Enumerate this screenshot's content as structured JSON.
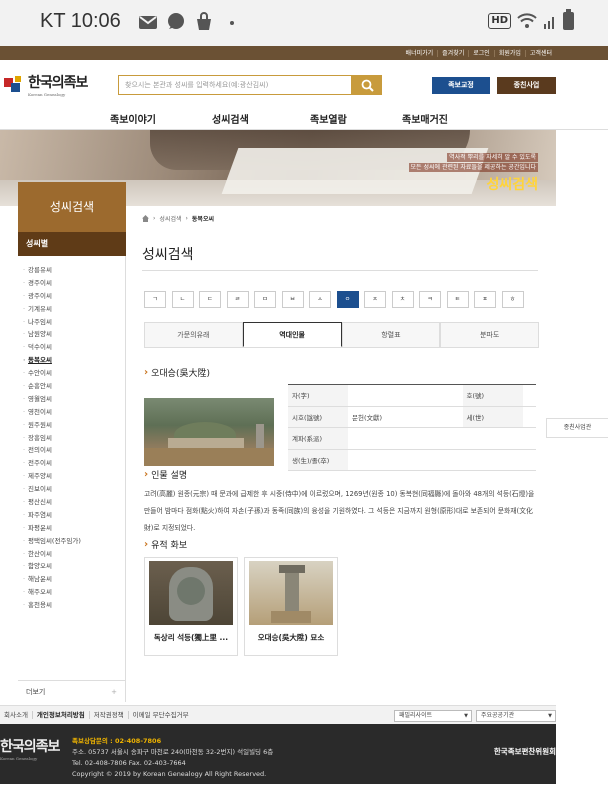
{
  "status_bar": {
    "carrier_time": "KT 10:06",
    "hd": "HD"
  },
  "util_links": [
    "배너미가기",
    "즐겨찾기",
    "로그인",
    "회원가입",
    "고객센터"
  ],
  "logo": {
    "title": "한국의족보",
    "subtitle": "Korean Genealogy"
  },
  "search": {
    "placeholder": "찾으시는 본관과 성씨를 입력하세요(예:광산김씨)"
  },
  "header_buttons": {
    "primary": "족보교정",
    "secondary": "종친사업"
  },
  "gnb": [
    "족보이야기",
    "성씨검색",
    "족보열람",
    "족보매거진"
  ],
  "banner": {
    "line1": "역사적 뿌리를 자세히 알 수 있도록",
    "line2": "모든 성씨에 관련된 자료들을 제공하는 공간입니다",
    "title": "성씨검색"
  },
  "sidebar": {
    "title": "성씨검색",
    "subtitle": "성씨별",
    "items": [
      "강릉유씨",
      "경주이씨",
      "광주이씨",
      "기계유씨",
      "나주임씨",
      "남원양씨",
      "덕수이씨",
      "동복오씨",
      "수안이씨",
      "순흥안씨",
      "영월엄씨",
      "영천이씨",
      "원주원씨",
      "장흥임씨",
      "전의이씨",
      "전주이씨",
      "제주양씨",
      "진보이씨",
      "평산신씨",
      "파주염씨",
      "파평윤씨",
      "평택임씨(전주임가)",
      "한산이씨",
      "함양오씨",
      "해남윤씨",
      "해주오씨",
      "홍천용씨"
    ],
    "active_index": 7,
    "more_label": "더보기",
    "more_icon": "+"
  },
  "breadcrumb": {
    "parent": "성씨검색",
    "current": "동복오씨"
  },
  "main": {
    "title": "성씨검색",
    "consonants": [
      "ㄱ",
      "ㄴ",
      "ㄷ",
      "ㄹ",
      "ㅁ",
      "ㅂ",
      "ㅅ",
      "ㅇ",
      "ㅈ",
      "ㅊ",
      "ㅋ",
      "ㅌ",
      "ㅍ",
      "ㅎ"
    ],
    "active_consonant": 7,
    "tabs": [
      "가문의유래",
      "역대인물",
      "항렬표",
      "분파도"
    ],
    "active_tab": 1,
    "person_name": "오대승(吳大陞)",
    "info_rows": [
      {
        "k1": "자(字)",
        "v1": "",
        "k2": "호(號)",
        "v2": ""
      },
      {
        "k1": "시호(諡號)",
        "v1": "문헌(文獻)",
        "k2": "세(世)",
        "v2": ""
      },
      {
        "k1": "계파(系派)",
        "v1": ""
      },
      {
        "k1": "생(生)/졸(卒)",
        "v1": ""
      }
    ],
    "desc_title": "인물 설명",
    "desc_text": "고려(高麗) 원종(元宗) 때 문과에 급제한 후 시중(侍中)에 이르렀으며, 1269년(원종 10) 동복현(同福縣)에 돌아와 48개의 석등(石燈)을 만들어 밤마다 점화(點火)하여 자손(子孫)과 동족(同族)의 융성을 기원하였다. 그 석등은 지금까지 원형(原形)대로 보존되어 문화재(文化財)로 지정되었다.",
    "relic_title": "유적 화보",
    "relics": [
      "독상리 석등(獨上里 ...",
      "오대승(吳大陞) 묘소"
    ]
  },
  "right_tab": "종친사업관",
  "footer_links": [
    "회사소개",
    "개인정보처리방침",
    "저작권정책",
    "이메일 무단수집거부"
  ],
  "footer_selects": [
    "패밀리사이트",
    "주요공공기관"
  ],
  "footer": {
    "logo": "한국의족보",
    "logo_sub": "Korean Genealogy",
    "tel_label": "족보상담문의 : 02-408-7806",
    "address": "주소. 05737 서울시 송파구 마천로 240(마천동 32-2번지) 석일빌딩 6층",
    "phone": "Tel. 02-408-7806 Fax. 02-403-7664",
    "copyright": "Copyright © 2019 by Korean Genealogy All Right Reserved.",
    "org": "한국족보편찬위원회"
  }
}
